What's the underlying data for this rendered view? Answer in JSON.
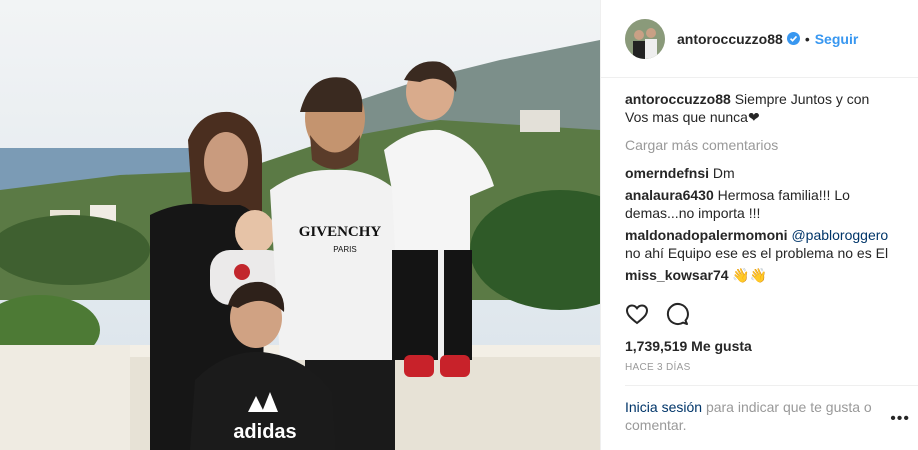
{
  "post": {
    "username": "antoroccuzzo88",
    "separator": "•",
    "follow_label": "Seguir",
    "caption": {
      "user": "antoroccuzzo88",
      "text": "Siempre Juntos y con Vos mas que nunca❤"
    },
    "load_more": "Cargar más comentarios",
    "comments": [
      {
        "user": "omerndefnsi",
        "text": "Dm"
      },
      {
        "user": "analaura6430",
        "text": "Hermosa familia!!! Lo demas...no importa !!!"
      },
      {
        "user": "maldonadopalermomoni",
        "mention": "@pabloroggero",
        "text": "no ahí Equipo ese es el problema no es El"
      },
      {
        "user": "miss_kowsar74",
        "text": "👋👋"
      }
    ],
    "likes": "1,739,519 Me gusta",
    "time": "HACE 3 DÍAS",
    "login_link": "Inicia sesión",
    "login_text": "para indicar que te gusta o comentar.",
    "menu": "•••"
  },
  "photo": {
    "shirt_text": "GIVENCHY",
    "shirt_subtext": "PARIS",
    "kid_shirt_text": "adidas"
  },
  "colors": {
    "accent": "#3897f0",
    "text": "#262626",
    "muted": "#999999",
    "link": "#003569"
  },
  "icons": [
    "verified-badge-icon",
    "heart-icon",
    "comment-icon",
    "more-options-icon"
  ]
}
